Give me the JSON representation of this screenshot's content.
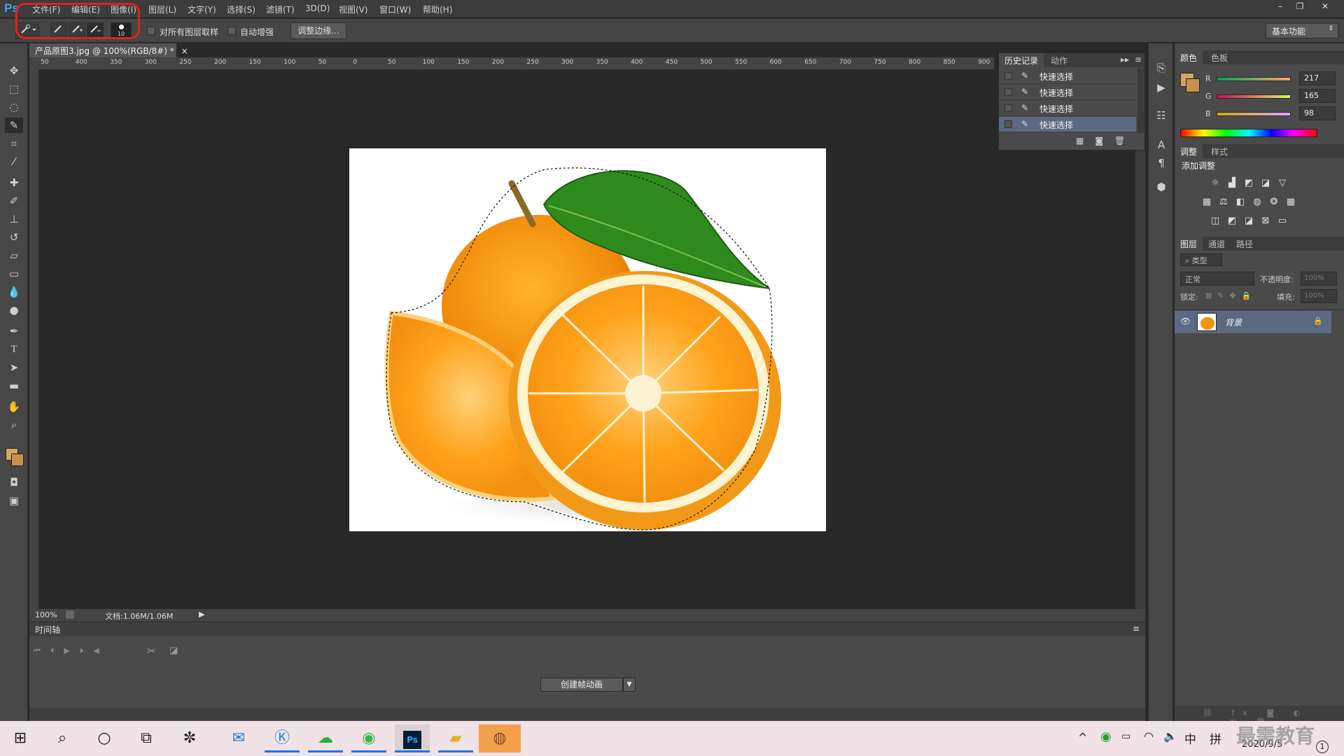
{
  "app": {
    "logo": "Ps"
  },
  "menu": [
    "文件(F)",
    "编辑(E)",
    "图像(I)",
    "图层(L)",
    "文字(Y)",
    "选择(S)",
    "滤镜(T)",
    "3D(D)",
    "视图(V)",
    "窗口(W)",
    "帮助(H)"
  ],
  "window_controls": {
    "minimize": "–",
    "restore": "❐",
    "close": "✕"
  },
  "options": {
    "brush_size": "10",
    "sample_all_layers": "对所有图层取样",
    "auto_enhance": "自动增强",
    "refine_edge": "调整边缘...",
    "workspace": "基本功能"
  },
  "document": {
    "tab_title": "产品原图3.jpg @ 100%(RGB/8#) *",
    "close_glyph": "×",
    "zoom": "100%",
    "doc_size": "文档:1.06M/1.06M",
    "ruler_ticks": [
      "50",
      "400",
      "350",
      "300",
      "250",
      "200",
      "150",
      "100",
      "50",
      "0",
      "50",
      "100",
      "150",
      "200",
      "250",
      "300",
      "350",
      "400",
      "450",
      "500",
      "550",
      "600",
      "650",
      "700",
      "750",
      "800",
      "850",
      "900"
    ]
  },
  "timeline": {
    "title": "时间轴",
    "create_button": "创建帧动画"
  },
  "history": {
    "tabs": [
      "历史记录",
      "动作"
    ],
    "items": [
      "快速选择",
      "快速选择",
      "快速选择",
      "快速选择"
    ],
    "selected_index": 3
  },
  "color_panel": {
    "tabs": [
      "颜色",
      "色板"
    ],
    "r_label": "R",
    "g_label": "G",
    "b_label": "B",
    "r": "217",
    "g": "165",
    "b": "98",
    "foreground": "#d9a562",
    "background": "#c8914a"
  },
  "adjustments_panel": {
    "tabs": [
      "调整",
      "样式"
    ],
    "subtitle": "添加调整"
  },
  "layers_panel": {
    "tabs": [
      "图层",
      "通道",
      "路径"
    ],
    "filter": "类型",
    "blend_mode": "正常",
    "opacity_label": "不透明度:",
    "opacity": "100%",
    "lock_label": "锁定:",
    "fill_label": "填充:",
    "fill": "100%",
    "layer_name": "背景"
  },
  "taskbar": {
    "ime_1": "中",
    "ime_2": "拼",
    "date": "2020/9/5",
    "watermark": "最需教育",
    "notification_count": "1"
  }
}
